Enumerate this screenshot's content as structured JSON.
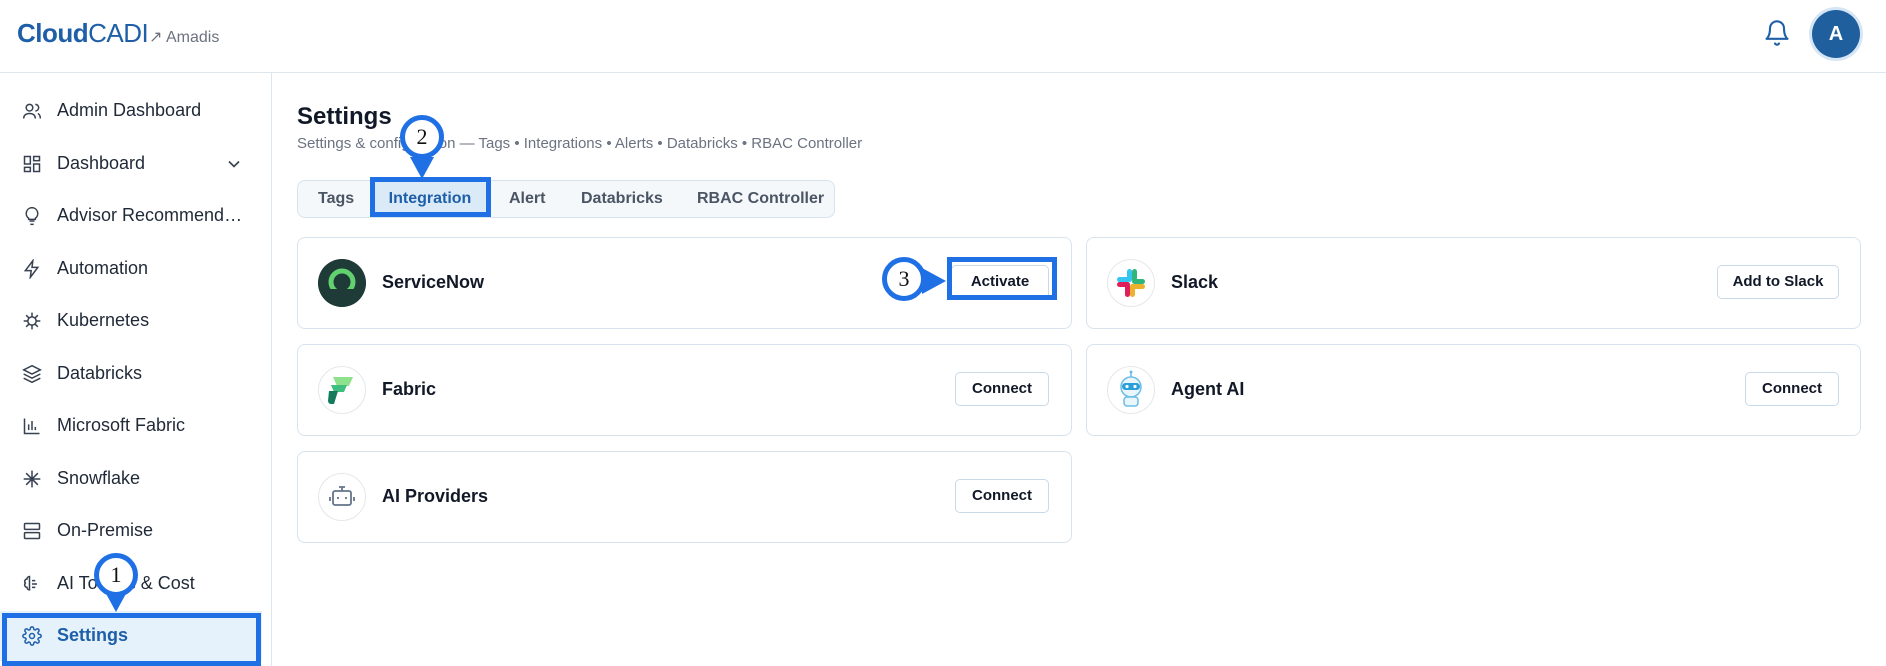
{
  "header": {
    "logo_bold": "Cloud",
    "logo_thin": "CADI",
    "org": "↗ Amadis",
    "avatar_initial": "A"
  },
  "sidebar": {
    "items": [
      {
        "label": "Admin Dashboard",
        "icon": "users-icon"
      },
      {
        "label": "Dashboard",
        "icon": "grid-icon"
      },
      {
        "label": "Advisor Recommendations",
        "icon": "lightbulb-icon"
      },
      {
        "label": "Automation",
        "icon": "bolt-icon"
      },
      {
        "label": "Kubernetes",
        "icon": "helm-icon"
      },
      {
        "label": "Databricks",
        "icon": "layers-icon"
      },
      {
        "label": "Microsoft Fabric",
        "icon": "bar-chart-icon"
      },
      {
        "label": "Snowflake",
        "icon": "snowflake-icon"
      },
      {
        "label": "On-Premise",
        "icon": "server-icon"
      },
      {
        "label": "AI Tokens & Cost",
        "icon": "brain-icon"
      },
      {
        "label": "Settings",
        "icon": "gear-icon"
      }
    ]
  },
  "main": {
    "title": "Settings",
    "subtitle": "Settings & configuration — Tags • Integrations • Alerts • Databricks • RBAC Controller",
    "tabs": [
      "Tags",
      "Integration",
      "Alert",
      "Databricks",
      "RBAC Controller"
    ],
    "active_tab": "Integration",
    "integrations": [
      {
        "name": "ServiceNow",
        "action": "Activate"
      },
      {
        "name": "Slack",
        "action": "Add to Slack"
      },
      {
        "name": "Fabric",
        "action": "Connect"
      },
      {
        "name": "Agent AI",
        "action": "Connect"
      },
      {
        "name": "AI Providers",
        "action": "Connect"
      }
    ]
  },
  "annotations": {
    "step1": "1",
    "step2": "2",
    "step3": "3",
    "color": "#1f6fe5"
  },
  "colors": {
    "brand": "#1e5fa8",
    "active_bg": "#e6f2fb",
    "border": "#d7e3ee"
  }
}
